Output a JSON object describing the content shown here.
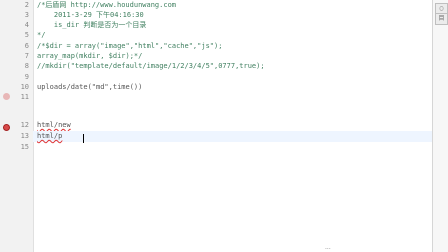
{
  "editor": {
    "lines": [
      {
        "num": "2",
        "text": "/*后盾网 http://www.houdunwang.com",
        "style": "comment"
      },
      {
        "num": "3",
        "text": "    2011-3-29 下午04:16:30",
        "style": "comment"
      },
      {
        "num": "4",
        "text": "    is_dir 判断是否为一个目录",
        "style": "comment"
      },
      {
        "num": "5",
        "text": "*/",
        "style": "comment"
      },
      {
        "num": "6",
        "text": "/*$dir = array(\"image\",\"html\",\"cache\",\"js\");",
        "style": "comment"
      },
      {
        "num": "7",
        "text": "array_map(mkdir, $dir);*/",
        "style": "comment"
      },
      {
        "num": "8",
        "text": "//mkdir(\"template/default/image/1/2/3/4/5\",0777,true);",
        "style": "comment"
      },
      {
        "num": "9",
        "text": "",
        "style": "code"
      },
      {
        "num": "10",
        "text": "uploads/date(\"md\",time())",
        "style": "code"
      },
      {
        "num": "11",
        "text": "",
        "style": "code"
      },
      {
        "num": "12",
        "text": "html/new",
        "style": "code"
      },
      {
        "num": "13",
        "text": "html/p",
        "style": "code"
      },
      {
        "num": "15",
        "text": "",
        "style": "code"
      }
    ]
  },
  "right_panel": {
    "buttons": [
      "▢",
      "目"
    ]
  },
  "status": {
    "text": "..."
  }
}
